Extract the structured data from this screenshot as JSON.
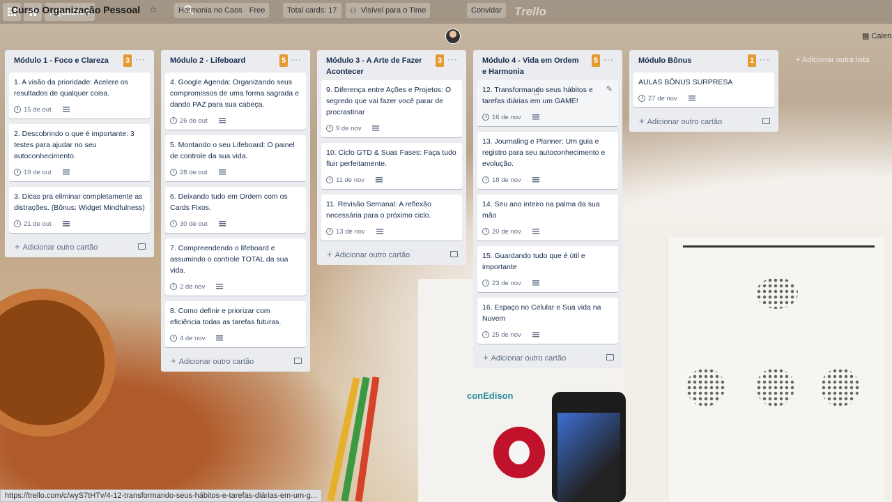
{
  "topbar": {
    "boards_label": "Quadros",
    "logo": "Trello"
  },
  "board": {
    "title": "Curso Organização Pessoal",
    "team": "Harmonia no Caos",
    "plan": "Free",
    "total_cards": "Total cards: 17",
    "visibility": "Visível para o Time",
    "invite": "Convidar",
    "calendar": "Calen",
    "add_list": "Adicionar outra lista"
  },
  "lists": [
    {
      "title": "Módulo 1 - Foco e Clareza",
      "count": "3",
      "cards": [
        {
          "text": "1. A visão da prioridade: Acelere os resultados de qualquer coisa.",
          "due": "15 de out"
        },
        {
          "text": "2. Descobrindo o que é importante: 3 testes para ajudar no seu autoconhecimento.",
          "due": "19 de out"
        },
        {
          "text": "3. Dicas pra eliminar completamente as distrações. (Bônus: Widget Mindfulness)",
          "due": "21 de out"
        }
      ],
      "add_card": "Adicionar outro cartão"
    },
    {
      "title": "Módulo 2 - Lifeboard",
      "count": "5",
      "cards": [
        {
          "text": "4. Google Agenda: Organizando seus compromissos de uma forma sagrada e dando PAZ para sua cabeça.",
          "due": "26 de out"
        },
        {
          "text": "5. Montando o seu Lifeboard: O painel de controle da sua vida.",
          "due": "28 de out"
        },
        {
          "text": "6. Deixando tudo em Ordem com os Cards Fixos.",
          "due": "30 de out"
        },
        {
          "text": "7. Compreendendo o lifeboard e assumindo o controle TOTAL da sua vida.",
          "due": "2 de nov"
        },
        {
          "text": "8. Como definir e priorizar com eficiência todas as tarefas futuras.",
          "due": "4 de nov"
        }
      ],
      "add_card": "Adicionar outro cartão"
    },
    {
      "title": "Módulo 3 - A Arte de Fazer Acontecer",
      "count": "3",
      "cards": [
        {
          "text": "9. Diferença entre Ações e Projetos: O segredo que vai fazer você parar de procrastinar",
          "due": "9 de nov"
        },
        {
          "text": "10. Ciclo GTD & Suas Fases: Faça tudo fluir perfeitamente.",
          "due": "11 de nov"
        },
        {
          "text": "11. Revisão Semanal: A reflexão necessária para o próximo ciclo.",
          "due": "13 de nov"
        }
      ],
      "add_card": "Adicionar outro cartão"
    },
    {
      "title": "Módulo 4 - Vida em Ordem e Harmonia",
      "count": "5",
      "cards": [
        {
          "text": "12. Transformando seus hábitos e tarefas diárias em um GAME!",
          "due": "16 de nov"
        },
        {
          "text": "13. Journaling e Planner: Um guia e registro para seu autoconhecimento e evolução.",
          "due": "18 de nov"
        },
        {
          "text": "14. Seu ano inteiro na palma da sua mão",
          "due": "20 de nov"
        },
        {
          "text": "15. Guardando tudo que é útil e importante",
          "due": "23 de nov"
        },
        {
          "text": "16. Espaço no Celular e Sua vida na Nuvem",
          "due": "25 de nov"
        }
      ],
      "add_card": "Adicionar outro cartão"
    },
    {
      "title": "Módulo Bônus",
      "count": "1",
      "cards": [
        {
          "text": "AULAS BÔNUS SURPRESA",
          "due": "27 de nov"
        }
      ],
      "add_card": "Adicionar outro cartão"
    }
  ],
  "statusbar": {
    "url": "https://trello.com/c/wyS7tHTv/4-12-transformando-seus-hábitos-e-tarefas-diárias-em-um-g..."
  },
  "background": {
    "conedison": "conEdison",
    "lg": "LG"
  },
  "colors": {
    "count_badge": "#e49a31",
    "list_bg": "#ebecf0",
    "text": "#172b4d"
  }
}
